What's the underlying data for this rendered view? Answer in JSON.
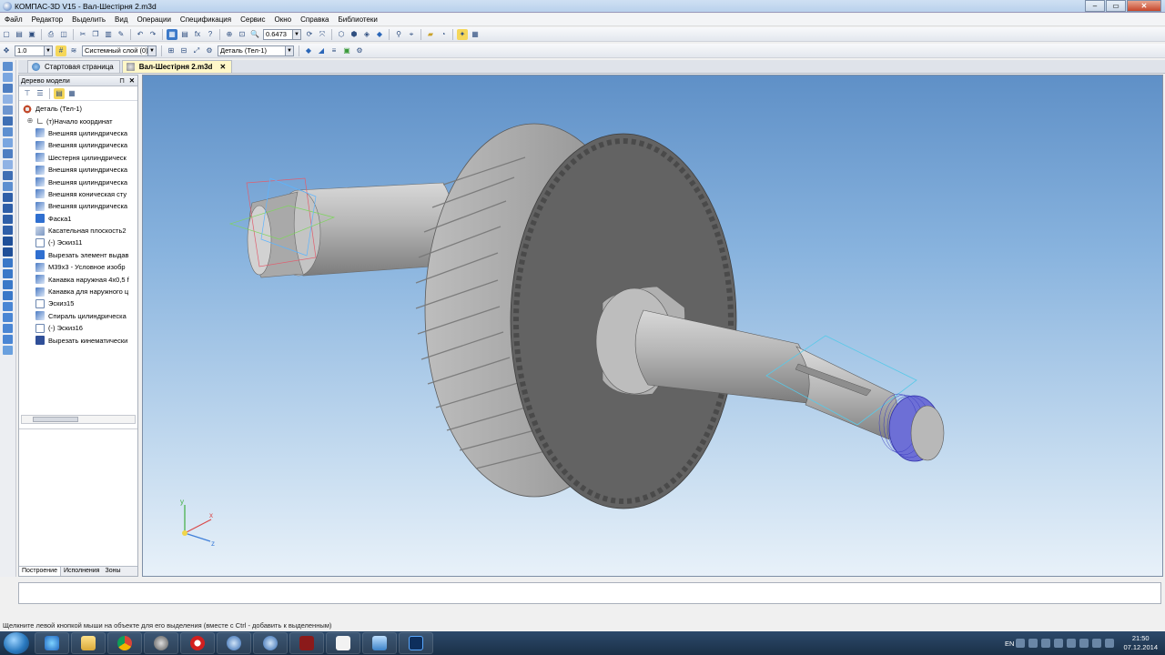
{
  "window": {
    "title": "КОМПАС-3D V15 - Вал-Шестірня 2.m3d"
  },
  "menu": [
    "Файл",
    "Редактор",
    "Выделить",
    "Вид",
    "Операции",
    "Спецификация",
    "Сервис",
    "Окно",
    "Справка",
    "Библиотеки"
  ],
  "toolbar": {
    "zoom_value": "0.6473",
    "step_value": "1.0",
    "layer_value": "Системный слой (0)",
    "part_value": "Деталь (Тел-1)"
  },
  "tabs": [
    {
      "label": "Стартовая страница",
      "active": false
    },
    {
      "label": "Вал-Шестірня 2.m3d",
      "active": true
    }
  ],
  "tree": {
    "header": "Дерево модели",
    "root": "Деталь (Тел-1)",
    "origin": "(т)Начало координат",
    "items": [
      "Внешняя цилиндрическа",
      "Внешняя цилиндрическа",
      "Шестерня цилиндрическ",
      "Внешняя цилиндрическа",
      "Внешняя цилиндрическа",
      "Внешняя коническая сту",
      "Внешняя цилиндрическа",
      "Фаска1",
      "Касательная плоскость2",
      "(-) Эскиз11",
      "Вырезать элемент выдав",
      "М39х3 - Условное изобр",
      "Канавка наружная 4х0,5 f",
      "Канавка для наружного ц",
      "Эскиз15",
      "Спираль цилиндрическа",
      "(-) Эскиз16",
      "Вырезать кинематически"
    ],
    "bottom_tabs": [
      "Построение",
      "Исполнения",
      "Зоны"
    ]
  },
  "axes": {
    "x": "x",
    "y": "y",
    "z": "z"
  },
  "status": {
    "hint": "Щелкните левой кнопкой мыши на объекте для его выделения (вместе с Ctrl - добавить к выделенным)"
  },
  "taskbar": {
    "lang": "EN",
    "time": "21:50",
    "date": "07.12.2014"
  }
}
